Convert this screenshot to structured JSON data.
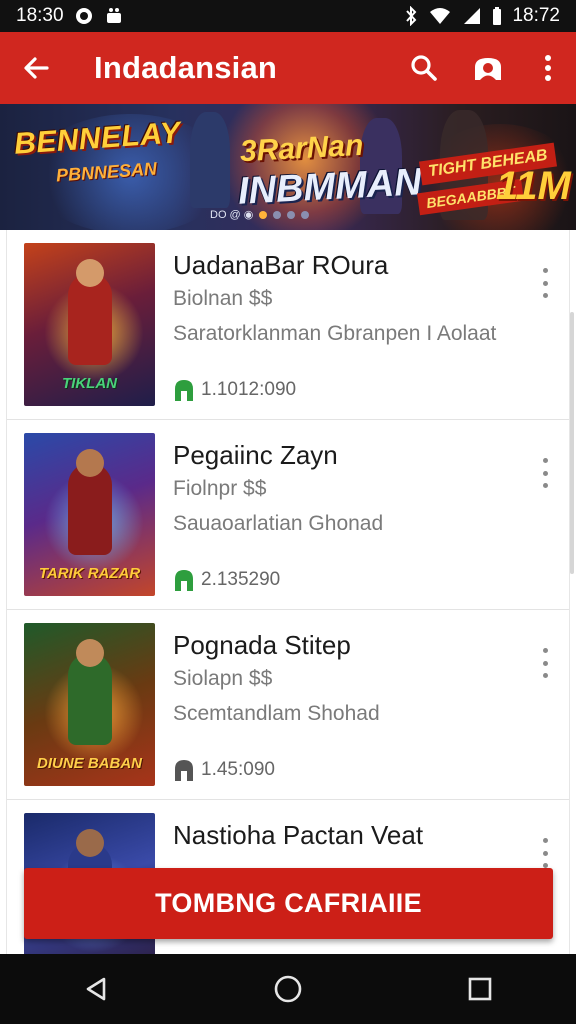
{
  "status_bar": {
    "time_left": "18:30",
    "time_right": "18:72"
  },
  "app_bar": {
    "title": "Indadansian",
    "back_icon": "arrow-left-icon",
    "search_icon": "search-icon",
    "account_icon": "account-icon",
    "menu_icon": "more-vertical-icon"
  },
  "banner": {
    "left_title": "BENNELAY",
    "left_subtitle": "PBNNESAN",
    "mid_title": "3RarNan",
    "mid_subtitle": "INBMMAN",
    "right_tag1": "TIGHT BEHEAB",
    "right_tag2": "BEGAABBBT",
    "right_big": "11M",
    "pager_label": "DO @ ◉"
  },
  "items": [
    {
      "name": "UadanaBar ROura",
      "price": "Biolnan $$",
      "description": "Saratorklanman Gbranpen I Aolaat",
      "count": "1.1012:090",
      "thumb_label": "TIKLAN",
      "stat_color": "#2e9e3e"
    },
    {
      "name": "Pegaiinc Zayn",
      "price": "Fiolnpr $$",
      "description": "Sauaoarlatian Ghonad",
      "count": "2.135290",
      "thumb_label": "TARIK RAZAR",
      "stat_color": "#2e9e3e"
    },
    {
      "name": "Pognada Stitep",
      "price": "Siolapn $$",
      "description": "Scemtandlam Shohad",
      "count": "1.45:090",
      "thumb_label": "DIUNE BABAN",
      "stat_color": "#555555"
    },
    {
      "name": "Nastioha Pactan Veat",
      "price": "",
      "description": "",
      "count": "",
      "thumb_label": "",
      "stat_color": "#2e9e3e"
    }
  ],
  "cta": {
    "label": "TOMBNG CAFRIAIIE"
  },
  "colors": {
    "primary": "#d0271f",
    "cta": "#cc1f17"
  },
  "nav_bar": {
    "back_icon": "nav-back-triangle-icon",
    "home_icon": "nav-home-circle-icon",
    "recents_icon": "nav-recents-square-icon"
  }
}
